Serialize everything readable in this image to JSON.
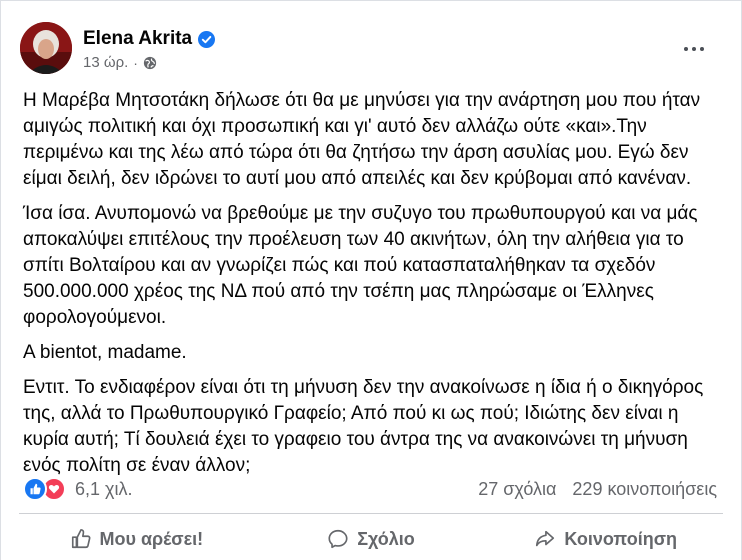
{
  "post": {
    "author": "Elena Akrita",
    "timestamp": "13 ώρ.",
    "separator": "·",
    "paragraphs": [
      "Η Μαρέβα Μητσοτάκη δήλωσε ότι θα με μηνύσει για την ανάρτηση μου που ήταν αμιγώς πολιτική και όχι προσωπική και γι' αυτό δεν αλλάζω ούτε «και».Την περιμένω και της λέω από τώρα ότι θα ζητήσω την άρση ασυλίας μου. Εγώ δεν είμαι δειλή, δεν ιδρώνει το αυτί μου από απειλές και δεν κρύβομαι από κανέναν.",
      "Ίσα ίσα. Ανυπομονώ να βρεθούμε με την συζυγο του πρωθυπουργού και να μάς αποκαλύψει επιτέλους την προέλευση των 40 ακινήτων, όλη την αλήθεια για το σπίτι Βολταίρου και αν γνωρίζει πώς και πού κατασπαταλήθηκαν τα σχεδόν 500.000.000 χρέος της ΝΔ πού από την τσέπη μας πληρώσαμε οι Έλληνες φορολογούμενοι.",
      "A bientot, madame.",
      "Εντιτ. Το ενδιαφέρον είναι ότι τη μήνυση δεν την ανακοίνωσε η ίδια ή ο δικηγόρος της, αλλά το Πρωθυπουργικό Γραφείο; Από πού κι ως πού; Ιδιώτης δεν είναι η κυρία αυτή; Τί δουλειά έχει το γραφειο του άντρα της να ανακοινώνει τη μήνυση ενός πολίτη σε έναν άλλον;"
    ],
    "reaction_count": "6,1 χιλ.",
    "comments": "27 σχόλια",
    "shares": "229 κοινοποιήσεις",
    "actions": {
      "like": "Μου αρέσει!",
      "comment": "Σχόλιο",
      "share": "Κοινοποίηση"
    }
  },
  "colors": {
    "like_blue": "#1877f2",
    "love_red": "#f33e58",
    "secondary_text": "#65676b"
  },
  "icons": [
    "verified-badge-icon",
    "globe-icon",
    "more-options-icon",
    "like-reaction-icon",
    "love-reaction-icon",
    "like-thumb-icon",
    "comment-bubble-icon",
    "share-arrow-icon"
  ]
}
